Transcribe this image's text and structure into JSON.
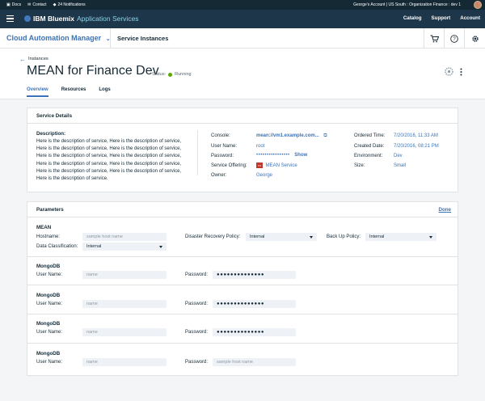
{
  "topstrip": {
    "docs": "Docs",
    "contact": "Contact",
    "notifications": "24 Notifications",
    "account_info": "George's Account  |  US South : Organization Finance : dev 1"
  },
  "nav": {
    "brand_bold": "IBM Bluemix",
    "brand_light": "Application Services",
    "links": [
      "Catalog",
      "Support",
      "Account"
    ]
  },
  "subheader": {
    "app_name": "Cloud Automation Manager",
    "section": "Service Instances"
  },
  "page": {
    "back_label": "Instances",
    "title": "MEAN for Finance Dev",
    "status_label": "Status:",
    "status_value": "Running",
    "status_color": "#5aa700",
    "tabs": [
      "Overview",
      "Resources",
      "Logs"
    ]
  },
  "details": {
    "heading": "Service Details",
    "description_label": "Description:",
    "description_lines": [
      "Here is the description of service, Here is the description of service,",
      "Here is the description of service, Here is the description of service,",
      "Here is the description of service, Here is the description of service,",
      "Here is the description of service, Here is the description of service,",
      "Here is the description of service, Here is the description of service,",
      "Here is the description of service."
    ],
    "console_label": "Console:",
    "console_value": "mean://vm1.example.com...",
    "username_label": "User Name:",
    "username_value": "root",
    "password_label": "Password:",
    "password_value": "••••••••••••••••",
    "password_show": "Show",
    "offering_label": "Service Offering:",
    "offering_value": "MEAN Service",
    "owner_label": "Owner:",
    "owner_value": "George",
    "ordered_label": "Ordered Time:",
    "ordered_value": "7/20/2016, 11:33 AM",
    "created_label": "Created Date:",
    "created_value": "7/20/2016, 08:21 PM",
    "env_label": "Environment:",
    "env_value": "Dev",
    "size_label": "Size:",
    "size_value": "Small"
  },
  "params": {
    "heading": "Parameters",
    "done": "Done",
    "mean": {
      "title": "MEAN",
      "hostname_label": "Hostname:",
      "hostname_placeholder": "sample host name",
      "dr_label": "Disaster Recovery Policy:",
      "dr_value": "Internal",
      "backup_label": "Back Up Policy:",
      "backup_value": "Internal",
      "class_label": "Data Classification:",
      "class_value": "Internal"
    },
    "mongo": [
      {
        "title": "MongoDB",
        "user_label": "User Name:",
        "user_placeholder": "name",
        "pw_label": "Password:",
        "pw_value": "●●●●●●●●●●●●●●",
        "pw_placeholder": ""
      },
      {
        "title": "MongoDB",
        "user_label": "User Name:",
        "user_placeholder": "name",
        "pw_label": "Password:",
        "pw_value": "●●●●●●●●●●●●●●",
        "pw_placeholder": ""
      },
      {
        "title": "MongoDB",
        "user_label": "User Name:",
        "user_placeholder": "name",
        "pw_label": "Password:",
        "pw_value": "●●●●●●●●●●●●●●",
        "pw_placeholder": ""
      },
      {
        "title": "MongoDB",
        "user_label": "User Name:",
        "user_placeholder": "name",
        "pw_label": "Password:",
        "pw_value": "",
        "pw_placeholder": "sample host name"
      }
    ]
  },
  "colors": {
    "accent": "#3b73b9",
    "nav_bg": "#1d3649",
    "strip_bg": "#152935"
  }
}
